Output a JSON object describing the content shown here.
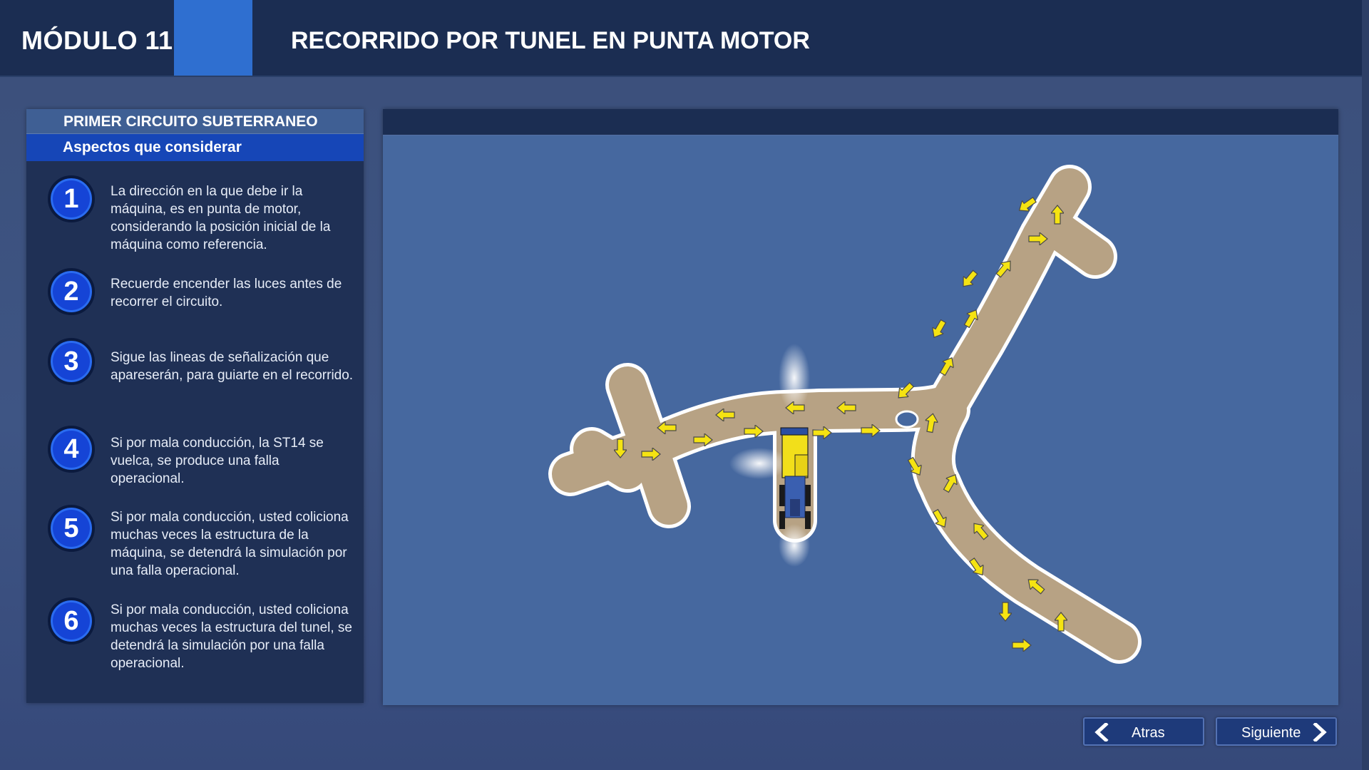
{
  "header": {
    "module": "MÓDULO 11",
    "title": "RECORRIDO POR TUNEL EN PUNTA MOTOR"
  },
  "panel": {
    "title": "PRIMER CIRCUITO SUBTERRANEO",
    "subtitle": "Aspectos que considerar",
    "steps": [
      {
        "number": "1",
        "text": "La dirección en la que debe ir la máquina, es en punta de motor, considerando la posición inicial de la máquina como referencia."
      },
      {
        "number": "2",
        "text": "Recuerde encender las luces antes de recorrer el circuito."
      },
      {
        "number": "3",
        "text": "Sigue las lineas de señalización que apareserán, para guiarte en el recorrido."
      },
      {
        "number": "4",
        "text": "Si por mala conducción, la  ST14 se  vuelca, se produce una falla operacional."
      },
      {
        "number": "5",
        "text": "Si por mala conducción, usted coliciona muchas veces la estructura de la máquina, se detendrá la simulación por una falla operacional."
      },
      {
        "number": "6",
        "text": "Si por mala conducción, usted coliciona muchas veces la estructura del tunel, se detendrá la simulación por una falla operacional."
      }
    ]
  },
  "map": {
    "tunnel_color": "#b7a284",
    "arrow_color": "#f5e312",
    "machine_color": "#f2df1a",
    "icons": [
      "tunnel-map",
      "direction-arrow-icon",
      "loader-vehicle-icon"
    ]
  },
  "nav": {
    "back_label": "Atras",
    "next_label": "Siguiente",
    "back_icon": "chevron-left-icon",
    "next_icon": "chevron-right-icon"
  },
  "colors": {
    "header_bg": "#1b2d52",
    "accent": "#2f6fd0",
    "step_badge": "#1544d6",
    "map_bg": "#46689f"
  }
}
